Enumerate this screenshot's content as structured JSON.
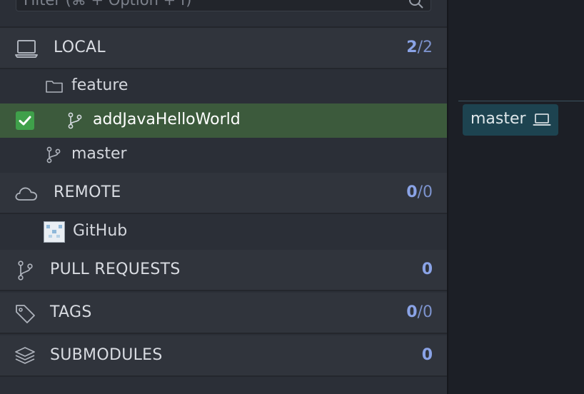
{
  "filter": {
    "placeholder": "Filter (⌘ + Option + f)"
  },
  "local": {
    "label": "LOCAL",
    "count_current": "2",
    "count_sep": "/",
    "count_total": "2",
    "folder": "feature",
    "branches": [
      {
        "label": "addJavaHelloWorld",
        "checked_out": true
      },
      {
        "label": "master",
        "checked_out": false
      }
    ]
  },
  "remote": {
    "label": "REMOTE",
    "count_current": "0",
    "count_sep": "/",
    "count_total": "0",
    "items": [
      {
        "label": "GitHub"
      }
    ]
  },
  "pull_requests": {
    "label": "PULL REQUESTS",
    "count": "0"
  },
  "tags": {
    "label": "TAGS",
    "count_current": "0",
    "count_sep": "/",
    "count_total": "0"
  },
  "submodules": {
    "label": "SUBMODULES",
    "count": "0"
  },
  "graph": {
    "branch_tag": "master"
  },
  "colors": {
    "active_row": "#3c5a3c",
    "checkbox": "#3fa04a",
    "count": "#8aa3e6",
    "branch_tag": "#1d4350"
  }
}
